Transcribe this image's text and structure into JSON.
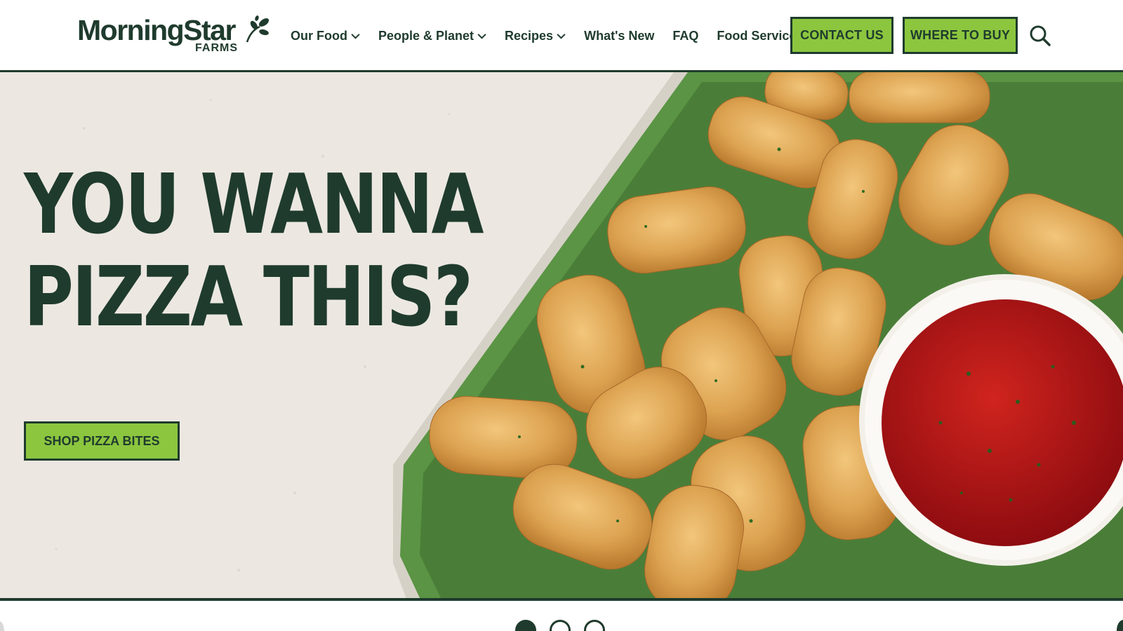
{
  "brand": {
    "name": "MorningStar",
    "sub": "FARMS"
  },
  "nav": {
    "items": [
      {
        "label": "Our Food",
        "has_dropdown": true
      },
      {
        "label": "People & Planet",
        "has_dropdown": true
      },
      {
        "label": "Recipes",
        "has_dropdown": true
      },
      {
        "label": "What's New",
        "has_dropdown": false
      },
      {
        "label": "FAQ",
        "has_dropdown": false
      },
      {
        "label": "Food Service",
        "has_dropdown": false
      }
    ],
    "contact_label": "CONTACT US",
    "buy_label": "WHERE TO BUY",
    "search_icon": "search-icon"
  },
  "hero": {
    "title_line1": "YOU WANNA",
    "title_line2": "PIZZA THIS?",
    "cta_label": "SHOP PIZZA BITES",
    "image_subject": "pizza bites on green tray with marinara dip"
  },
  "carousel": {
    "slide_count": 3,
    "active_index": 0
  },
  "colors": {
    "brand_dark": "#1f3b2d",
    "brand_green": "#8cc63f",
    "tray_green": "#4f8a3e",
    "sauce_red": "#b3121a"
  }
}
